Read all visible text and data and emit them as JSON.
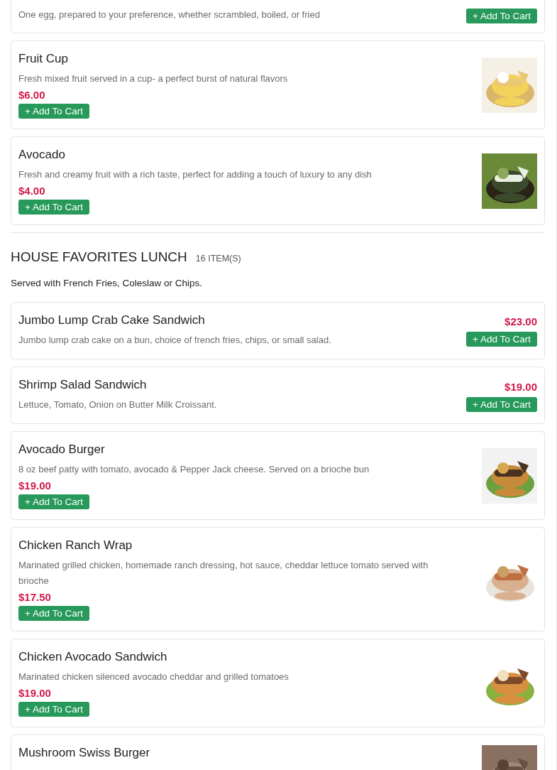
{
  "top_items": [
    {
      "description": "One egg, prepared to your preference, whether scrambled, boiled, or fried",
      "button": "+ Add To Cart",
      "kind": "side"
    },
    {
      "name": "Fruit Cup",
      "description": "Fresh mixed fruit served in a cup- a perfect burst of natural flavors",
      "price": "$6.00",
      "button": "+ Add To Cart",
      "kind": "picture"
    },
    {
      "name": "Avocado",
      "description": "Fresh and creamy fruit with a rich taste, perfect for adding a touch of luxury to any dish",
      "price": "$4.00",
      "button": "+ Add To Cart",
      "kind": "picture"
    }
  ],
  "section": {
    "title": "HOUSE FAVORITES LUNCH",
    "count": "16 ITEM(S)",
    "note": "Served with French Fries, Coleslaw or Chips.",
    "items": [
      {
        "name": "Jumbo Lump Crab Cake Sandwich",
        "description": "Jumbo lump crab cake on a bun, choice of french fries, chips, or small salad.",
        "price": "$23.00",
        "button": "+ Add To Cart",
        "kind": "side"
      },
      {
        "name": "Shrimp Salad Sandwich",
        "description": "Lettuce, Tomato, Onion on Butter Milk Croissant.",
        "price": "$19.00",
        "button": "+ Add To Cart",
        "kind": "side"
      },
      {
        "name": "Avocado Burger",
        "description": "8 oz beef patty with tomato, avocado & Pepper Jack cheese. Served on a brioche bun",
        "price": "$19.00",
        "button": "+ Add To Cart",
        "kind": "picture"
      },
      {
        "name": "Chicken Ranch Wrap",
        "description": "Marinated grilled chicken, homemade ranch dressing, hot sauce, cheddar lettuce tomato served with brioche",
        "price": "$17.50",
        "button": "+ Add To Cart",
        "kind": "picture"
      },
      {
        "name": "Chicken Avocado Sandwich",
        "description": "Marinated chicken silenced avocado cheddar and grilled tomatoes",
        "price": "$19.00",
        "button": "+ Add To Cart",
        "kind": "picture"
      },
      {
        "name": "Mushroom Swiss Burger",
        "kind": "picture"
      }
    ]
  }
}
